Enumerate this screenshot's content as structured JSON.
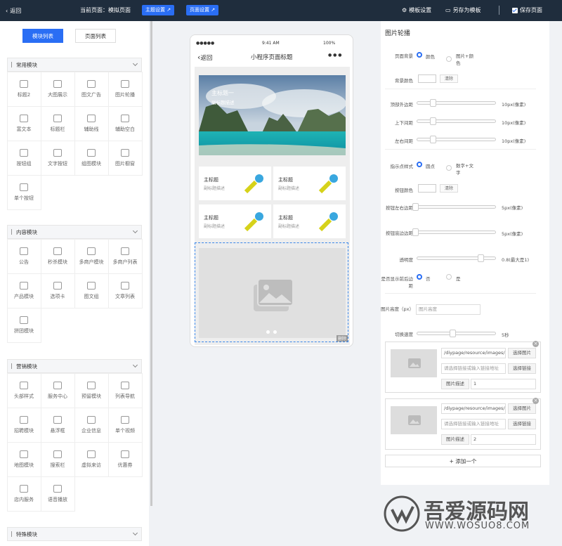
{
  "topbar": {
    "back": "返回",
    "current_page": "当前页面：模拟页面",
    "theme_btn": "主题设置",
    "page_btn": "页面设置",
    "template_settings": "模板设置",
    "save_as_template": "另存为模板",
    "save_page": "保存页面"
  },
  "left_tabs": {
    "modules": "模块列表",
    "pages": "页面列表"
  },
  "groups": [
    {
      "title": "常用模块",
      "items": [
        "标题2",
        "大图展示",
        "图文广告",
        "图片轮播",
        "富文本",
        "标题栏",
        "辅助线",
        "辅助空白",
        "按钮组",
        "文字按钮",
        "组图模块",
        "图片橱窗",
        "单个按钮"
      ]
    },
    {
      "title": "内容模块",
      "items": [
        "公告",
        "秒杀模块",
        "多商户模块",
        "多商户列表",
        "产品模块",
        "选项卡",
        "图文组",
        "文章列表",
        "拼团模块"
      ]
    },
    {
      "title": "营销模块",
      "items": [
        "头部样式",
        "服务中心",
        "预留模块",
        "列表导航",
        "招聘模块",
        "悬浮框",
        "企业信息",
        "单个视频",
        "地图模块",
        "搜索栏",
        "虚拟来访",
        "优惠券",
        "店内服务",
        "语音播放"
      ]
    },
    {
      "title": "特殊模块",
      "items": []
    }
  ],
  "phone": {
    "signal": "●●●●●",
    "time": "9:41 AM",
    "battery": "100%",
    "back": "返回",
    "title": "小程序页面标题",
    "more": "● ● ●",
    "banner_title": "主标题一",
    "banner_sub": "副标题描述",
    "cards": [
      {
        "t": "主标题",
        "s": "副标题描述"
      },
      {
        "t": "主标题",
        "s": "副标题描述"
      },
      {
        "t": "主标题",
        "s": "副标题描述"
      },
      {
        "t": "主标题",
        "s": "副标题描述"
      }
    ],
    "delete": "删除"
  },
  "panel": {
    "title": "图片轮播",
    "bg_label": "页面背景",
    "bg_opt1": "颜色",
    "bg_opt2": "图片+颜色",
    "bg_color_label": "背景颜色",
    "clear": "清除",
    "top_margin": "顶部外边距",
    "top_margin_val": "10px(像素)",
    "vpad": "上下间距",
    "vpad_val": "10px(像素)",
    "hpad": "左右间距",
    "hpad_val": "10px(像素)",
    "dot_style": "指示点样式",
    "dot_opt1": "圆点",
    "dot_opt2": "数字+文字",
    "btn_color": "按钮颜色",
    "btn_lr": "按钮左右边距",
    "btn_lr_val": "5px(像素)",
    "btn_bottom": "按钮底边边距",
    "btn_bottom_val": "5px(像素)",
    "opacity": "透明度",
    "opacity_val": "0.8(最大是1)",
    "show_border": "是否显示前后边距",
    "no": "否",
    "yes": "是",
    "img_height": "图片高度（px）",
    "img_height_ph": "图片高度",
    "speed": "切换速度",
    "speed_val": "5秒",
    "images": [
      {
        "path": "/diypage/resource/images/",
        "choose": "选择图片",
        "link_ph": "请选择链接或输入链接地址",
        "choose_link": "选择链接",
        "desc_label": "图片描述",
        "desc": "1"
      },
      {
        "path": "/diypage/resource/images/",
        "choose": "选择图片",
        "link_ph": "请选择链接或输入链接地址",
        "choose_link": "选择链接",
        "desc_label": "图片描述",
        "desc": "2"
      }
    ],
    "add": "+ 添加一个"
  },
  "watermark": {
    "text": "吾爱源码网",
    "url": "WWW.WOSUO8.COM"
  }
}
